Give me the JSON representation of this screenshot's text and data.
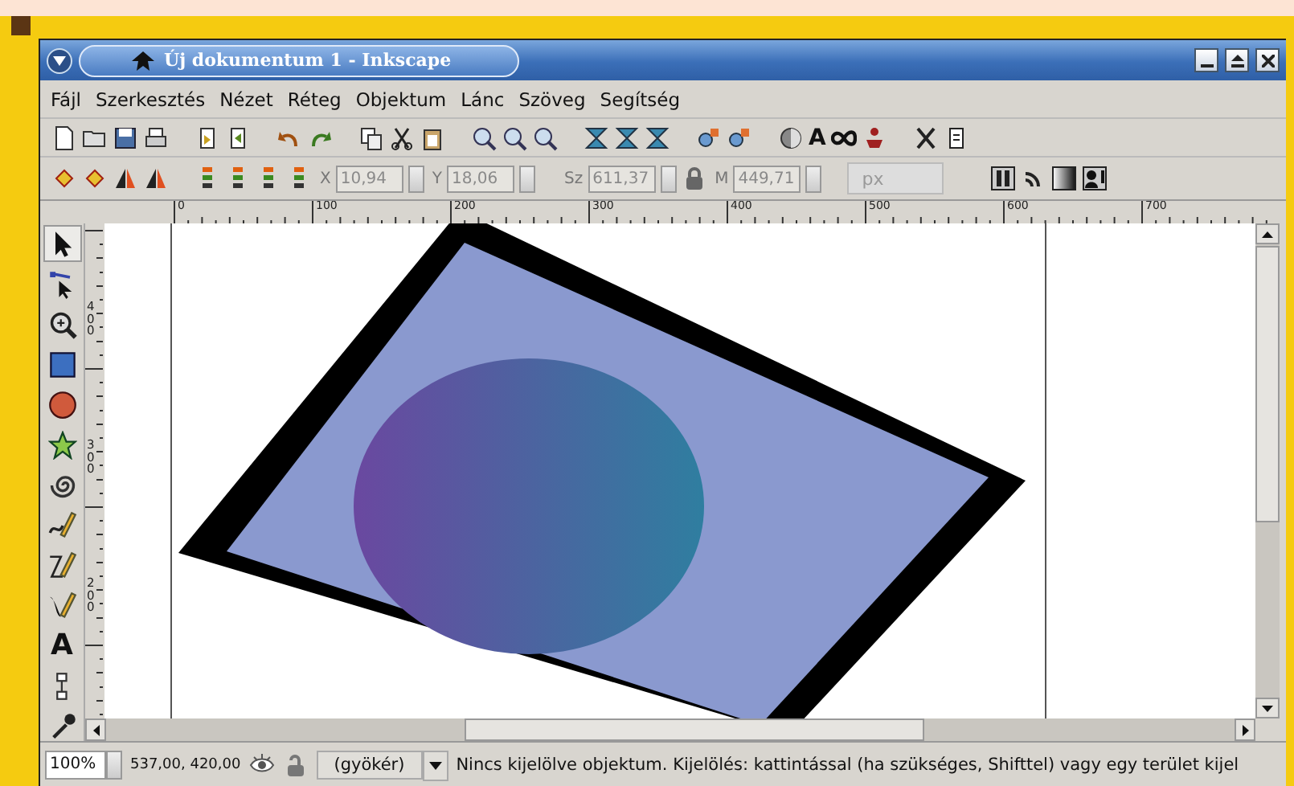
{
  "window": {
    "title": "Új dokumentum 1 - Inkscape"
  },
  "menu": [
    "Fájl",
    "Szerkesztés",
    "Nézet",
    "Réteg",
    "Objektum",
    "Lánc",
    "Szöveg",
    "Segítség"
  ],
  "commands_toolbar": {
    "text_glyph": "A"
  },
  "selector_toolbar": {
    "fields": [
      {
        "label": "X",
        "value": "10,94",
        "disabled": true
      },
      {
        "label": "Y",
        "value": "18,06",
        "disabled": true
      },
      {
        "label": "Sz",
        "value": "611,37",
        "disabled": true
      },
      {
        "label": "M",
        "value": "449,71",
        "disabled": true
      }
    ],
    "unit": "px"
  },
  "horizontal_ruler": [
    "0",
    "100",
    "200",
    "300",
    "400",
    "500",
    "600",
    "700"
  ],
  "vertical_ruler": [
    "400",
    "300",
    "200"
  ],
  "tools": [
    {
      "kind": "select",
      "selected": true
    },
    {
      "kind": "node",
      "selected": false
    },
    {
      "kind": "zoom",
      "selected": false
    },
    {
      "kind": "rect",
      "selected": false
    },
    {
      "kind": "ellipse",
      "selected": false
    },
    {
      "kind": "star",
      "selected": false
    },
    {
      "kind": "spiral",
      "selected": false
    },
    {
      "kind": "pencil",
      "selected": false
    },
    {
      "kind": "pen",
      "selected": false
    },
    {
      "kind": "calligraphy",
      "selected": false
    },
    {
      "kind": "text",
      "selected": false,
      "label": "A"
    },
    {
      "kind": "connector",
      "selected": false
    },
    {
      "kind": "dropper",
      "selected": false
    }
  ],
  "status_bar": {
    "zoom": "100%",
    "coordinates": "537,00, 420,00",
    "layer": "(gyökér)",
    "message": "Nincs kijelölve objektum. Kijelölés: kattintással (ha szükséges, Shifttel) vagy egy terület kijel"
  }
}
